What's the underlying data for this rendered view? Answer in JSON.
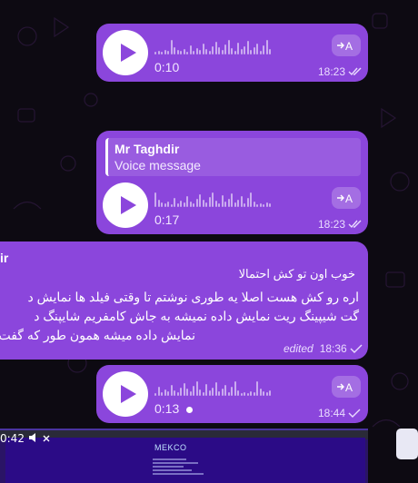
{
  "messages": [
    {
      "type": "voice",
      "duration": "0:10",
      "time": "18:23",
      "status": "read"
    },
    {
      "type": "voice",
      "reply_to": {
        "name": "Mr Taghdir",
        "text": "Voice message"
      },
      "duration": "0:17",
      "time": "18:23",
      "status": "read"
    },
    {
      "type": "text",
      "sender_partial": "ir",
      "quote": "خوب اون تو کش احتمالا",
      "lines": [
        "اره رو کش هست اصلا یه طوری نوشتم تا وقتی فیلد ها نمایش د",
        "گت شیپینگ ریت نمایش داده نمیشه به جاش کامفریم شایپنگ د",
        "نمایش داده میشه همون طور که گفت"
      ],
      "edited_label": "edited",
      "time": "18:36",
      "status": "sent"
    },
    {
      "type": "voice",
      "duration": "0:13",
      "time": "18:44",
      "status": "sent",
      "unplayed": true
    }
  ],
  "video_player": {
    "time": "0:42",
    "brand": "MEKCO"
  },
  "colors": {
    "bubble": "#8b46dc",
    "background": "#0d0a12"
  }
}
